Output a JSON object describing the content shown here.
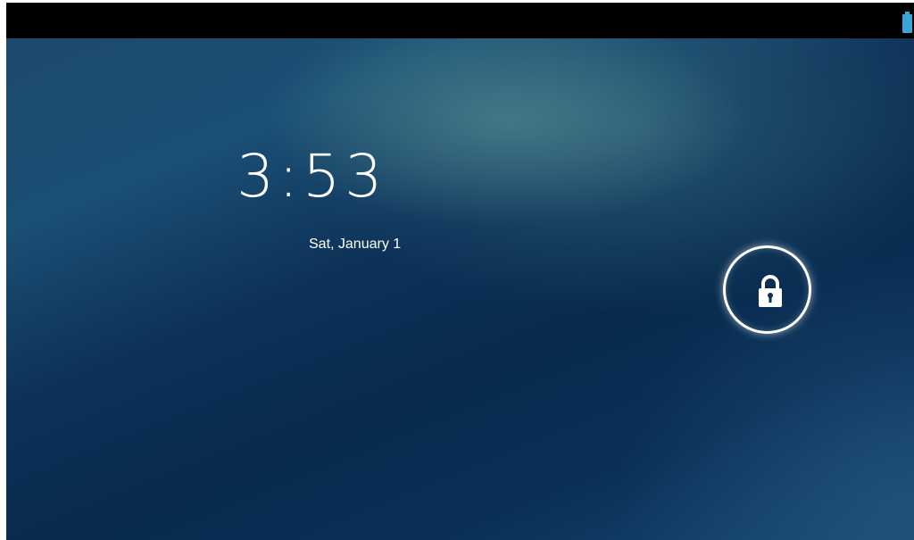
{
  "status_bar": {
    "battery_icon": "battery-icon",
    "battery_color": "#3aa6d8"
  },
  "lockscreen": {
    "time": "3:53",
    "date": "Sat, January 1",
    "unlock_icon": "lock-icon"
  },
  "colors": {
    "text": "#ffffff",
    "wallpaper_dark": "#082a4e",
    "wallpaper_light": "#4a8a8e"
  }
}
